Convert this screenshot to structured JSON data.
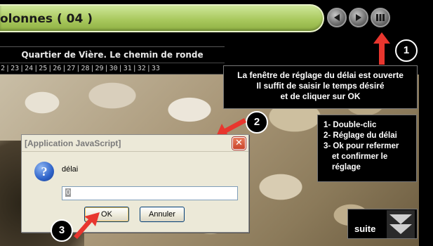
{
  "header": {
    "title": "olonnes ( 04 )",
    "nav_icons": [
      "previous-icon",
      "play-icon",
      "pause-icon"
    ]
  },
  "caption": {
    "text": "Quartier de Vière. Le chemin de ronde"
  },
  "page_numbers": [
    "2",
    "23",
    "24",
    "25",
    "26",
    "27",
    "28",
    "29",
    "30",
    "31",
    "32",
    "33"
  ],
  "callouts": {
    "top_lines": [
      "La fenêtre de réglage du délai est ouverte",
      "Il suffit de saisir le temps désiré",
      "et de cliquer sur OK"
    ],
    "steps": [
      "1- Double-clic",
      "2- Réglage du délai",
      "3- Ok pour refermer",
      "et confirmer le",
      "réglage"
    ]
  },
  "badges": {
    "one": "1",
    "two": "2",
    "three": "3"
  },
  "dialog": {
    "title": "[Application JavaScript]",
    "close_label": "✕",
    "message": "délai",
    "input_value": "0",
    "ok_label": "OK",
    "cancel_label": "Annuler"
  },
  "suite": {
    "label": "suite"
  },
  "colors": {
    "title_bar": "#a9c95e",
    "arrow_red": "#e8362e",
    "dialog_bg": "#ece9d8",
    "question_icon": "#2e63c9"
  }
}
